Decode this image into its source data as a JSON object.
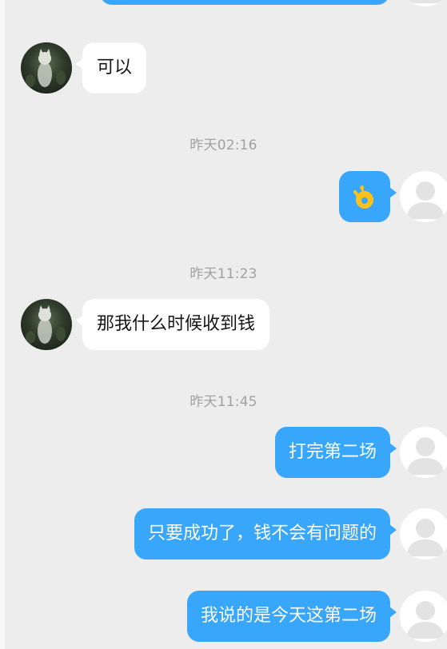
{
  "chat": {
    "messages": [
      {
        "side": "left",
        "text": "可以"
      },
      {
        "timestamp": "昨天02:16"
      },
      {
        "side": "right",
        "sticker": "ok-hand-emoji"
      },
      {
        "timestamp": "昨天11:23"
      },
      {
        "side": "left",
        "text": "那我什么时候收到钱"
      },
      {
        "timestamp": "昨天11:45"
      },
      {
        "side": "right",
        "text": "打完第二场"
      },
      {
        "side": "right",
        "text": "只要成功了，钱不会有问题的"
      },
      {
        "side": "right",
        "text": "我说的是今天这第二场"
      }
    ]
  },
  "colors": {
    "background": "#ededed",
    "outgoing_bubble": "#37a6fb",
    "incoming_bubble": "#ffffff",
    "timestamp_text": "#a1a1a1",
    "emoji_yellow": "#ffc017"
  },
  "icons": {
    "contact_avatar": "cat-photo-avatar",
    "self_avatar": "default-person-avatar",
    "sticker": "ok-hand-emoji"
  }
}
